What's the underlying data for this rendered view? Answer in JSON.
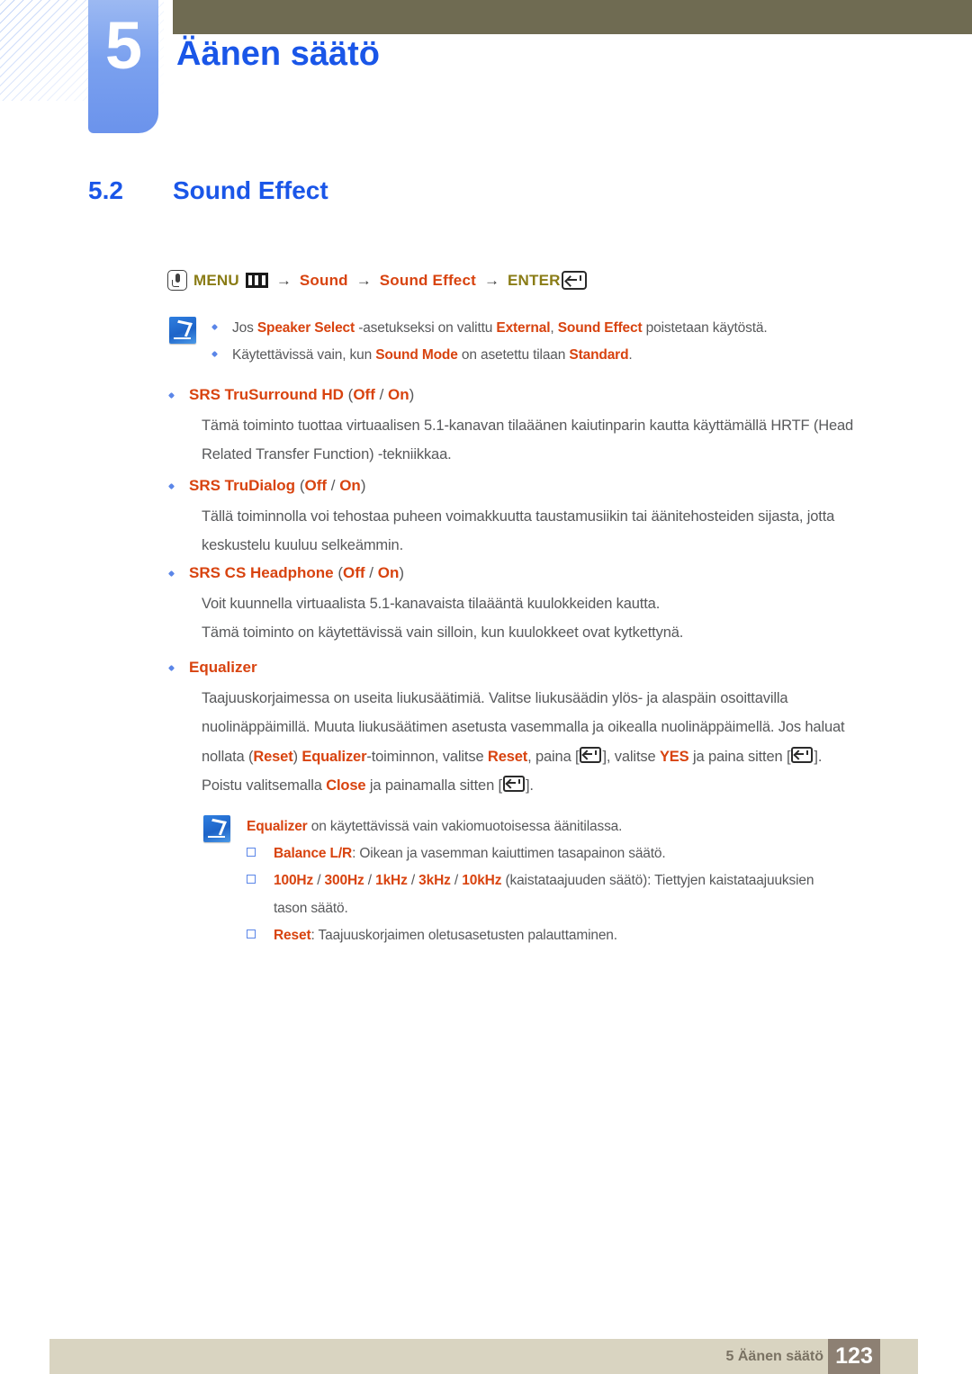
{
  "header": {
    "chapter_number": "5",
    "chapter_title": "Äänen säätö",
    "accent_blue": "#1a56e8",
    "olive_bar_color": "#6f6b52",
    "tab_gradient_from": "#9cb9f2",
    "tab_gradient_to": "#6b93ec"
  },
  "section": {
    "number": "5.2",
    "name": "Sound Effect"
  },
  "menu_path": {
    "touch_icon": "touch-hand-icon",
    "menu_label": "MENU",
    "menu_icon": "menu-grid-icon",
    "arrow": "→",
    "item1": "Sound",
    "item2": "Sound Effect",
    "enter_label": "ENTER",
    "enter_icon": "enter-key-icon",
    "olive_color": "#8a7c16",
    "orange_color": "#d8430f"
  },
  "note_top": {
    "icon": "note-pencil-icon",
    "items": [
      {
        "parts": [
          {
            "t": "Jos ",
            "hl": false
          },
          {
            "t": "Speaker Select",
            "hl": true
          },
          {
            "t": " -asetukseksi on valittu ",
            "hl": false
          },
          {
            "t": "External",
            "hl": true
          },
          {
            "t": ", ",
            "hl": false
          },
          {
            "t": "Sound Effect",
            "hl": true
          },
          {
            "t": " poistetaan käytöstä.",
            "hl": false
          }
        ]
      },
      {
        "parts": [
          {
            "t": "Käytettävissä vain, kun ",
            "hl": false
          },
          {
            "t": "Sound Mode",
            "hl": true
          },
          {
            "t": " on asetettu tilaan ",
            "hl": false
          },
          {
            "t": "Standard",
            "hl": true
          },
          {
            "t": ".",
            "hl": false
          }
        ]
      }
    ]
  },
  "body": {
    "srs_trusurround": {
      "title": "SRS TruSurround HD",
      "options": "(Off / On)",
      "line1": "Tämä toiminto tuottaa virtuaalisen 5.1-kanavan tilaäänen kaiutinparin kautta käyttämällä HRTF (Head",
      "line2": "Related Transfer Function) -tekniikkaa."
    },
    "srs_trudialog": {
      "title": "SRS TruDialog",
      "options": "(Off / On)",
      "line1": "Tällä toiminnolla voi tehostaa puheen voimakkuutta taustamusiikin tai äänitehosteiden sijasta, jotta",
      "line2": "keskustelu kuuluu selkeämmin."
    },
    "srs_cs_headphone": {
      "title": "SRS CS Headphone",
      "options": "(Off / On)",
      "line1": "Voit kuunnella virtuaalista 5.1-kanavaista tilaääntä kuulokkeiden kautta.",
      "line2": "Tämä toiminto on käytettävissä vain silloin, kun kuulokkeet ovat kytkettynä."
    },
    "equalizer": {
      "title": "Equalizer",
      "options": "",
      "line1": "Taajuuskorjaimessa on useita liukusäätimiä. Valitse liukusäädin ylös- ja alaspäin osoittavilla",
      "line2": "nuolinäppäimillä. Muuta liukusäätimen asetusta vasemmalla ja oikealla nuolinäppäimellä. Jos haluat",
      "line3_a": "nollata (",
      "line3_reset1": "Reset",
      "line3_b": ") ",
      "line3_equalizer": "Equalizer",
      "line3_c": "-toiminnon, valitse ",
      "line3_reset2": "Reset",
      "line3_d": ", paina [",
      "line3_e": "], valitse ",
      "line3_yes": "YES",
      "line3_f": " ja paina sitten [",
      "line3_g": "].",
      "line4_a": "Poistu valitsemalla ",
      "line4_close": "Close",
      "line4_b": " ja painamalla sitten [",
      "line4_c": "]."
    }
  },
  "note_bottom": {
    "icon": "note-pencil-icon",
    "intro_parts": [
      {
        "t": "Equalizer",
        "hl": true
      },
      {
        "t": " on käytettävissä vain vakiomuotoisessa äänitilassa.",
        "hl": false
      }
    ],
    "sub_items": [
      {
        "parts": [
          {
            "t": "Balance L/R",
            "hl": true
          },
          {
            "t": ": Oikean ja vasemman kaiuttimen tasapainon säätö.",
            "hl": false
          }
        ]
      },
      {
        "parts": [
          {
            "t": "100Hz",
            "hl": true
          },
          {
            "t": " / ",
            "hl": false
          },
          {
            "t": "300Hz",
            "hl": true
          },
          {
            "t": " / ",
            "hl": false
          },
          {
            "t": "1kHz",
            "hl": true
          },
          {
            "t": " / ",
            "hl": false
          },
          {
            "t": "3kHz",
            "hl": true
          },
          {
            "t": " / ",
            "hl": false
          },
          {
            "t": "10kHz",
            "hl": true
          },
          {
            "t": " (kaistataajuuden säätö): Tiettyjen kaistataajuuksien",
            "hl": false
          }
        ],
        "cont": "tason säätö."
      },
      {
        "parts": [
          {
            "t": "Reset",
            "hl": true
          },
          {
            "t": ": Taajuuskorjaimen oletusasetusten palauttaminen.",
            "hl": false
          }
        ]
      }
    ]
  },
  "footer": {
    "label": "5 Äänen säätö",
    "page_number": "123",
    "bar_color": "#d9d4c1",
    "page_box_color": "#8d8073"
  }
}
